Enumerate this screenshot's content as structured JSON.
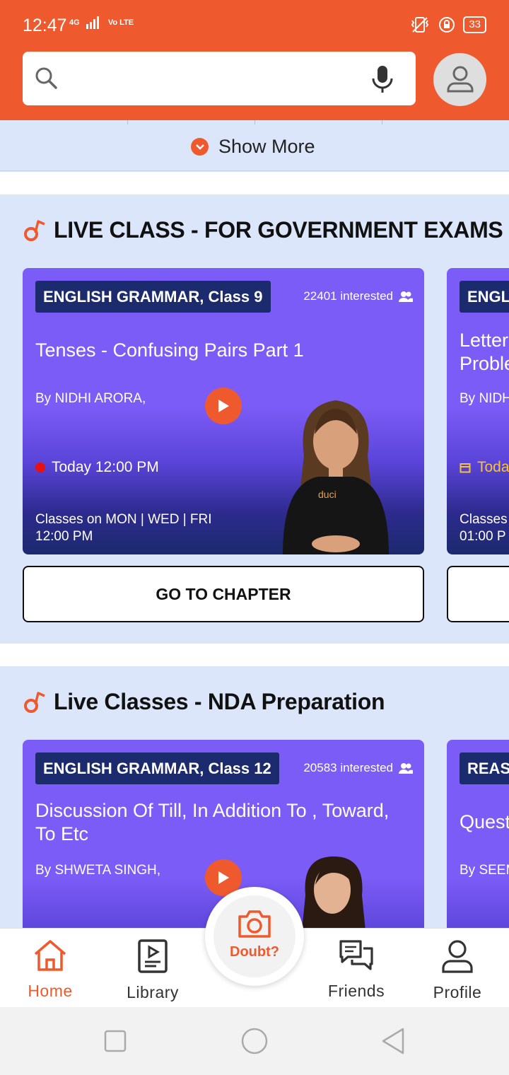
{
  "status_bar": {
    "time": "12:47",
    "network": "4G",
    "volte": "Vo LTE",
    "battery": "33"
  },
  "search": {
    "placeholder": ""
  },
  "show_more": {
    "label": "Show More"
  },
  "sections": [
    {
      "title": "LIVE CLASS - FOR GOVERNMENT EXAMS",
      "cards": [
        {
          "subject": "ENGLISH GRAMMAR, Class 9",
          "interested": "22401 interested",
          "title": "Tenses - Confusing Pairs Part 1",
          "author": "By NIDHI ARORA,",
          "time": "Today 12:00 PM",
          "schedule_line1": "Classes on MON | WED | FRI",
          "schedule_line2": "12:00 PM"
        },
        {
          "subject": "ENGL",
          "title_line1": "Letter",
          "title_line2": "Proble",
          "author": "By NIDH",
          "time": "Toda",
          "schedule_line1": "Classes",
          "schedule_line2": "01:00 P"
        }
      ],
      "button_label": "GO TO CHAPTER"
    },
    {
      "title": "Live Classes - NDA Preparation",
      "cards": [
        {
          "subject": "ENGLISH GRAMMAR, Class 12",
          "interested": "20583 interested",
          "title": "Discussion Of Till, In Addition To , Toward, To Etc",
          "author": "By SHWETA SINGH,"
        },
        {
          "subject": "REASO",
          "title": "Quest",
          "author": "By SEEM"
        }
      ]
    }
  ],
  "bottom_nav": {
    "home": "Home",
    "library": "Library",
    "doubt": "Doubt?",
    "friends": "Friends",
    "profile": "Profile"
  },
  "colors": {
    "brand": "#ee5a2d",
    "card": "#7c5cf7",
    "badge": "#1c2a6e",
    "background": "#dce6fb"
  }
}
